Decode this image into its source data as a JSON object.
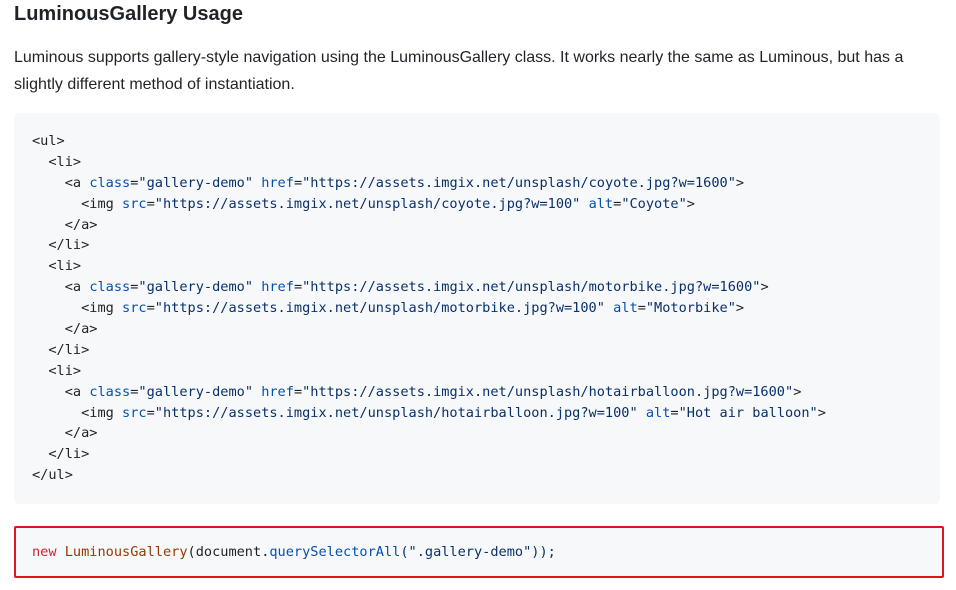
{
  "section": {
    "heading": "LuminousGallery Usage",
    "description": "Luminous supports gallery-style navigation using the LuminousGallery class. It works nearly the same as Luminous, but has a slightly different method of instantiation."
  },
  "html_code": {
    "ul_open": "<ul>",
    "ul_close": "</ul>",
    "li_open": "<li>",
    "li_close": "</li>",
    "a_close": "</a>",
    "items": [
      {
        "href": "\"https://assets.imgix.net/unsplash/coyote.jpg?w=1600\"",
        "src": "\"https://assets.imgix.net/unsplash/coyote.jpg?w=100\"",
        "alt": "\"Coyote\""
      },
      {
        "href": "\"https://assets.imgix.net/unsplash/motorbike.jpg?w=1600\"",
        "src": "\"https://assets.imgix.net/unsplash/motorbike.jpg?w=100\"",
        "alt": "\"Motorbike\""
      },
      {
        "href": "\"https://assets.imgix.net/unsplash/hotairballoon.jpg?w=1600\"",
        "src": "\"https://assets.imgix.net/unsplash/hotairballoon.jpg?w=100\"",
        "alt": "\"Hot air balloon\""
      }
    ],
    "class_value": "\"gallery-demo\""
  },
  "js_code": {
    "keyword": "new",
    "class_name": "LuminousGallery",
    "open_paren": "(",
    "object": "document",
    "dot": ".",
    "method": "querySelectorAll",
    "args": "(\".gallery-demo\"));"
  },
  "colors": {
    "highlight_border": "#e0141e",
    "code_background": "#f6f8fa"
  }
}
